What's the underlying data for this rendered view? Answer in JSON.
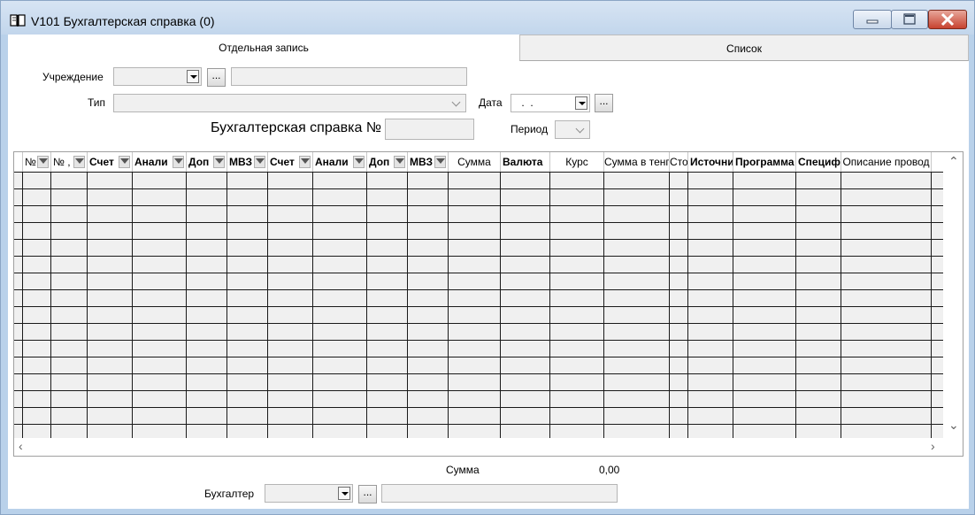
{
  "window": {
    "title": "V101 Бухгалтерская справка (0)",
    "icon": "book-icon",
    "controls": [
      "minimize-icon",
      "maximize-icon",
      "close-icon"
    ]
  },
  "tabs": [
    {
      "label": "Отдельная запись",
      "active": true
    },
    {
      "label": "Список",
      "active": false
    }
  ],
  "form": {
    "institution_label": "Учреждение",
    "type_label": "Тип",
    "date_label": "Дата",
    "date_value": " .  .",
    "doc_label": "Бухгалтерская справка №",
    "period_label": "Период",
    "browse_label": "..."
  },
  "grid": {
    "columns": [
      {
        "label": "№",
        "bold": false,
        "filter": true
      },
      {
        "label": "№ ,",
        "bold": false,
        "filter": true
      },
      {
        "label": "Счет",
        "bold": true,
        "filter": true
      },
      {
        "label": "Анали",
        "bold": true,
        "filter": true
      },
      {
        "label": "Доп",
        "bold": true,
        "filter": true
      },
      {
        "label": "МВЗ",
        "bold": true,
        "filter": true
      },
      {
        "label": "Счет",
        "bold": true,
        "filter": true
      },
      {
        "label": "Анали",
        "bold": true,
        "filter": true
      },
      {
        "label": "Доп",
        "bold": true,
        "filter": true
      },
      {
        "label": "МВЗ",
        "bold": true,
        "filter": true
      },
      {
        "label": "Сумма",
        "bold": false,
        "filter": false
      },
      {
        "label": "Валюта",
        "bold": true,
        "filter": false
      },
      {
        "label": "Курс",
        "bold": false,
        "filter": false
      },
      {
        "label": "Сумма в тенг",
        "bold": false,
        "filter": false
      },
      {
        "label": "Сто",
        "bold": false,
        "filter": false
      },
      {
        "label": "Источни",
        "bold": true,
        "filter": false
      },
      {
        "label": "Программа",
        "bold": true,
        "filter": false
      },
      {
        "label": "Специф",
        "bold": true,
        "filter": false
      },
      {
        "label": "Описание провод",
        "bold": false,
        "filter": false
      }
    ],
    "row_count": 16
  },
  "footer": {
    "sum_label": "Сумма",
    "sum_value": "0,00",
    "accountant_label": "Бухгалтер",
    "browse_label": "..."
  }
}
